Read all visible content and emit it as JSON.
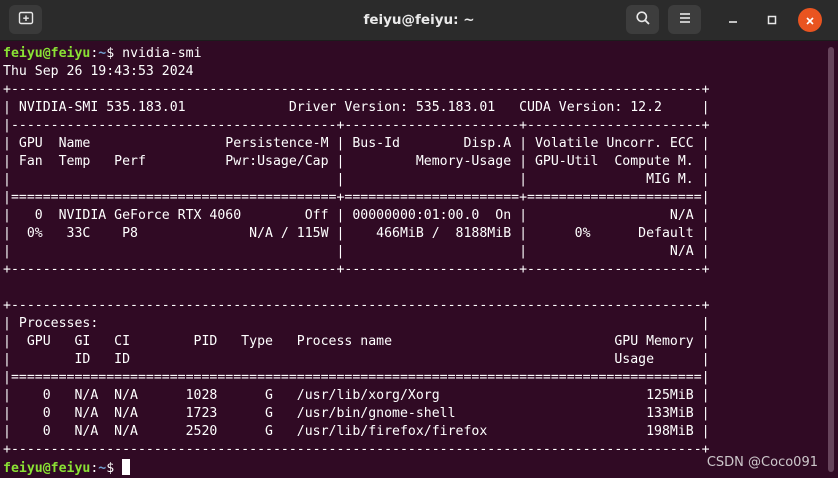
{
  "window": {
    "title": "feiyu@feiyu: ~",
    "icons": {
      "new_tab": "new-tab-icon",
      "search": "search-icon",
      "menu": "hamburger-menu-icon",
      "minimize": "minimize-icon",
      "maximize": "maximize-icon",
      "close": "close-icon"
    },
    "colors": {
      "close": "#e95420",
      "background": "#300a24",
      "prompt_user": "#8ae234",
      "prompt_path": "#729fcf"
    }
  },
  "terminal": {
    "prompt": {
      "user_host": "feiyu@feiyu",
      "sep": ":",
      "path": "~",
      "symbol": "$ "
    },
    "command": "nvidia-smi",
    "lines": [
      "Thu Sep 26 19:43:53 2024",
      "+---------------------------------------------------------------------------------------+",
      "| NVIDIA-SMI 535.183.01             Driver Version: 535.183.01   CUDA Version: 12.2     |",
      "|-----------------------------------------+----------------------+----------------------+",
      "| GPU  Name                 Persistence-M | Bus-Id        Disp.A | Volatile Uncorr. ECC |",
      "| Fan  Temp   Perf          Pwr:Usage/Cap |         Memory-Usage | GPU-Util  Compute M. |",
      "|                                         |                      |               MIG M. |",
      "|=========================================+======================+======================|",
      "|   0  NVIDIA GeForce RTX 4060        Off | 00000000:01:00.0  On |                  N/A |",
      "|  0%   33C    P8              N/A / 115W |    466MiB /  8188MiB |      0%      Default |",
      "|                                         |                      |                  N/A |",
      "+-----------------------------------------+----------------------+----------------------+",
      "",
      "+---------------------------------------------------------------------------------------+",
      "| Processes:                                                                            |",
      "|  GPU   GI   CI        PID   Type   Process name                            GPU Memory |",
      "|        ID   ID                                                             Usage      |",
      "|=======================================================================================|",
      "|    0   N/A  N/A      1028      G   /usr/lib/xorg/Xorg                          125MiB |",
      "|    0   N/A  N/A      1723      G   /usr/bin/gnome-shell                        133MiB |",
      "|    0   N/A  N/A      2520      G   /usr/lib/firefox/firefox                    198MiB |",
      "+---------------------------------------------------------------------------------------+"
    ]
  },
  "watermark": "CSDN @Coco091"
}
